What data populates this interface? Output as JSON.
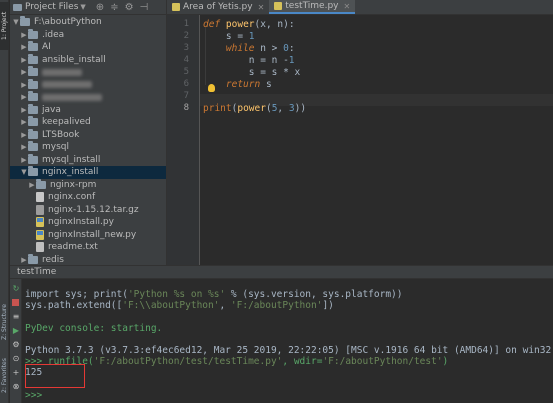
{
  "left_strip": {
    "tabs": [
      "1: Project",
      "Z: Structure",
      "2: Favorites"
    ]
  },
  "project_panel": {
    "header_title": "Project Files",
    "root": "F:\\aboutPython",
    "items": [
      {
        "name": ".idea",
        "type": "folder",
        "level": 1,
        "expanded": false
      },
      {
        "name": "AI",
        "type": "folder",
        "level": 1,
        "expanded": false
      },
      {
        "name": "ansible_install",
        "type": "folder",
        "level": 1,
        "expanded": false
      },
      {
        "name": "",
        "type": "folder",
        "level": 1,
        "expanded": false,
        "blurred": true
      },
      {
        "name": "",
        "type": "folder",
        "level": 1,
        "expanded": false,
        "blurred": true
      },
      {
        "name": "",
        "type": "folder",
        "level": 1,
        "expanded": false,
        "blurred": true
      },
      {
        "name": "java",
        "type": "folder",
        "level": 1,
        "expanded": false
      },
      {
        "name": "keepalived",
        "type": "folder",
        "level": 1,
        "expanded": false
      },
      {
        "name": "LTSBook",
        "type": "folder",
        "level": 1,
        "expanded": false
      },
      {
        "name": "mysql",
        "type": "folder",
        "level": 1,
        "expanded": false
      },
      {
        "name": "mysql_install",
        "type": "folder",
        "level": 1,
        "expanded": false
      },
      {
        "name": "nginx_install",
        "type": "folder",
        "level": 1,
        "expanded": true,
        "selected": true
      },
      {
        "name": "nginx-rpm",
        "type": "folder",
        "level": 2,
        "expanded": false
      },
      {
        "name": "nginx.conf",
        "type": "file",
        "level": 2
      },
      {
        "name": "nginx-1.15.12.tar.gz",
        "type": "gz",
        "level": 2
      },
      {
        "name": "nginxInstall.py",
        "type": "py",
        "level": 2
      },
      {
        "name": "nginxInstall_new.py",
        "type": "py",
        "level": 2
      },
      {
        "name": "readme.txt",
        "type": "txt",
        "level": 2
      },
      {
        "name": "redis",
        "type": "folder",
        "level": 1,
        "expanded": false
      }
    ]
  },
  "editor": {
    "tabs": [
      {
        "label": "Area of Yetis.py",
        "active": false
      },
      {
        "label": "testTime.py",
        "active": true
      }
    ],
    "line_numbers": [
      "1",
      "2",
      "3",
      "4",
      "5",
      "6",
      "7",
      "8"
    ],
    "code_lines": [
      "def power(x, n):",
      "    s = 1",
      "    while n > 0:",
      "        n = n -1",
      "        s = s * x",
      "    return s",
      "",
      "print(power(5, 3))"
    ],
    "current_line": 8
  },
  "run_panel": {
    "tab_label": "testTime",
    "console_lines": [
      "import sys; print('Python %s on %s' % (sys.version, sys.platform))",
      "sys.path.extend(['F:\\\\aboutPython', 'F:/aboutPython'])",
      "",
      "PyDev console: starting.",
      "",
      "Python 3.7.3 (v3.7.3:ef4ec6ed12, Mar 25 2019, 22:22:05) [MSC v.1916 64 bit (AMD64)] on win32",
      ">>> runfile('F:/aboutPython/test/testTime.py', wdir='F:/aboutPython/test')",
      "125",
      "",
      ">>>"
    ],
    "prompt": ">>>",
    "output_value": "125"
  },
  "colors": {
    "accent": "#4a88c7",
    "highlight_box": "#e53935",
    "selected_row": "#0d293e"
  }
}
